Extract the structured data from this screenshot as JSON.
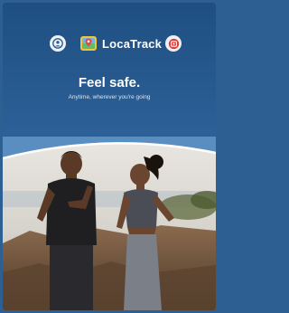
{
  "app": {
    "name": "LocaTrack",
    "headline": "Feel safe.",
    "subheadline": "Anytime, wherever you're going"
  },
  "icons": {
    "left": "profile-icon",
    "right": "sos-icon",
    "logo": "locatrack-logo-icon"
  },
  "colors": {
    "brand_blue": "#2d6198",
    "sos_red": "#e03b3b",
    "text": "#ffffff"
  },
  "hero_image": {
    "description_icon": "couple-running-photo"
  }
}
